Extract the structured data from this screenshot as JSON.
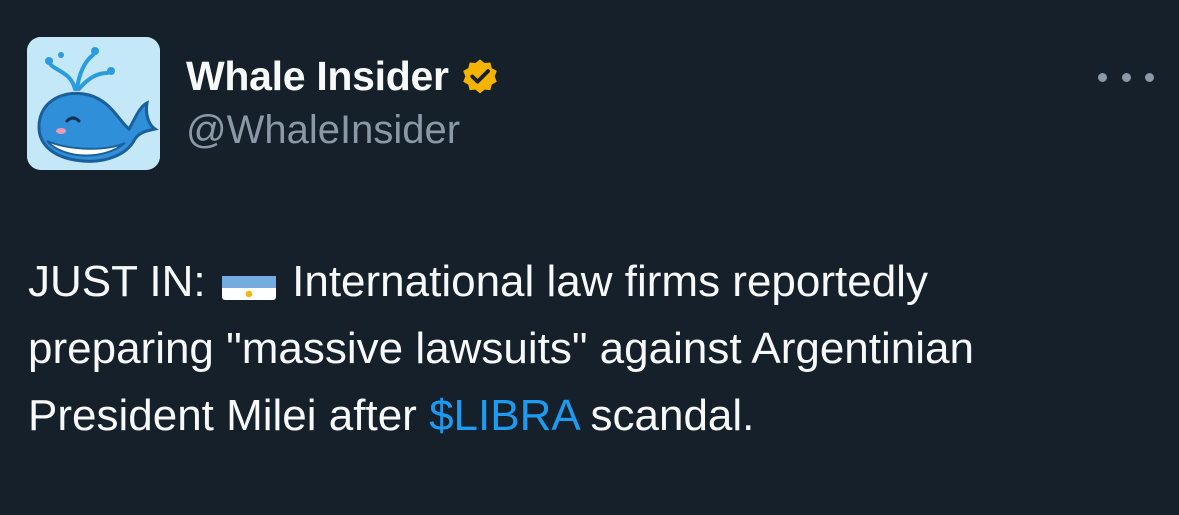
{
  "author": {
    "display_name": "Whale Insider",
    "handle": "@WhaleInsider",
    "verified": true,
    "verified_badge_color": "#f4b400",
    "avatar_icon": "whale-icon"
  },
  "more_menu_icon": "ellipsis-icon",
  "tweet": {
    "prefix": "JUST IN:",
    "flag_icon": "argentina-flag-icon",
    "line1_rest": "International law firms reportedly",
    "line2": "preparing \"massive lawsuits\" against Argentinian",
    "line3_start": "President Milei after ",
    "cashtag": "$LIBRA",
    "line3_end": " scandal."
  },
  "colors": {
    "background": "#15202b",
    "text": "#f7f9f9",
    "secondary_text": "#8b98a5",
    "link": "#1d9bf0"
  }
}
